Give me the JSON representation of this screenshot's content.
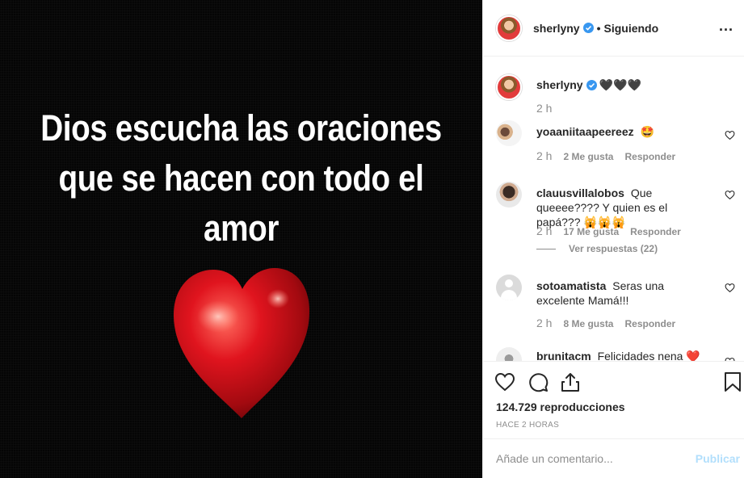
{
  "media": {
    "caption_lines": [
      "Dios escucha las oraciones",
      "que se hacen con todo el",
      "amor"
    ]
  },
  "header": {
    "username": "sherlyny",
    "separator": "•",
    "follow_label": "Siguiendo",
    "more_label": "..."
  },
  "caption": {
    "username": "sherlyny",
    "text": "🖤🖤🖤",
    "time": "2 h"
  },
  "comments": [
    {
      "username": "yoaaniitaapeereez",
      "text": "🤩",
      "time": "2 h",
      "likes": "2 Me gusta",
      "reply_label": "Responder"
    },
    {
      "username": "clauusvillalobos",
      "text": "Que queeee???? Y quien es el papá??? 🙀🙀🙀",
      "time": "2 h",
      "likes": "17 Me gusta",
      "reply_label": "Responder",
      "view_replies": "Ver respuestas (22)"
    },
    {
      "username": "sotoamatista",
      "text": "Seras una excelente Mamá!!!",
      "time": "2 h",
      "likes": "8 Me gusta",
      "reply_label": "Responder"
    },
    {
      "username": "brunitacm",
      "text": "Felicidades nena ❤️"
    }
  ],
  "actions": {
    "icons": [
      "heart-icon",
      "comment-icon",
      "share-icon",
      "bookmark-icon"
    ],
    "views": "124.729 reproducciones",
    "posted": "HACE 2 HORAS"
  },
  "comment_box": {
    "placeholder": "Añade un comentario...",
    "publish_label": "Publicar"
  },
  "colors": {
    "verified_blue": "#3897f0",
    "publish_disabled": "#b2dffc",
    "muted_text": "#8e8e8e",
    "heart_red": "#e0141e"
  }
}
